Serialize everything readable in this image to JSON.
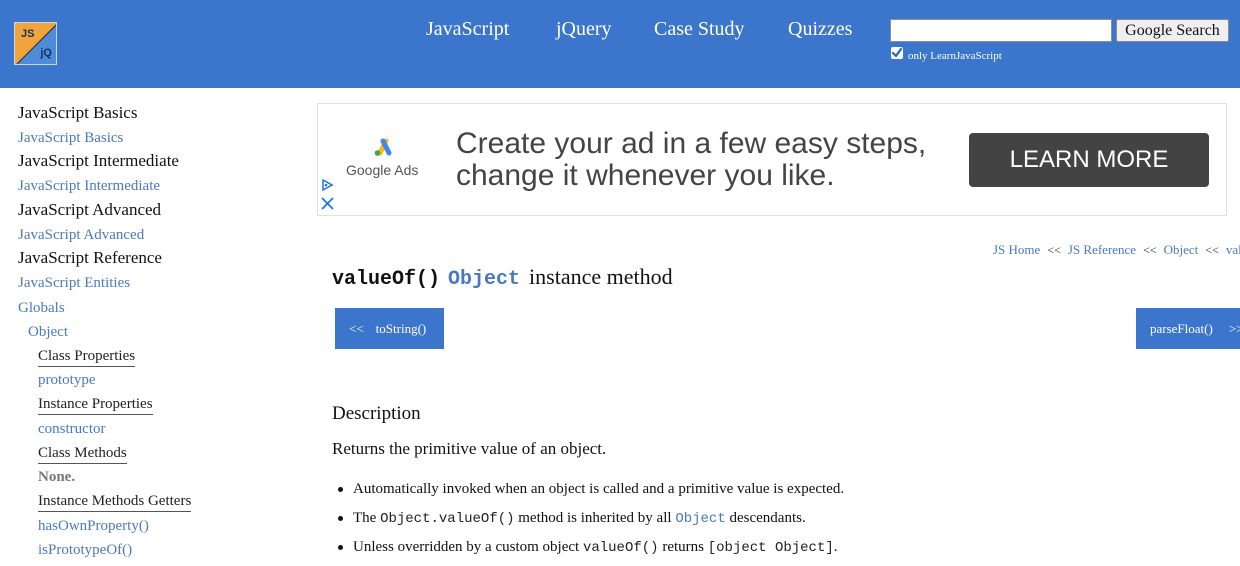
{
  "header": {
    "logo_top": "JS",
    "logo_bottom": "jQ",
    "nav": [
      "JavaScript",
      "jQuery",
      "Case Study",
      "Quizzes"
    ],
    "search_value": "",
    "search_button": "Google Search",
    "only_label": "only LearnJavaScript",
    "only_checked": true,
    "colors": {
      "bar": "#3b76cc",
      "logo_orange": "#f0a53c",
      "logo_blue": "#4e8bd8"
    }
  },
  "sidebar": [
    {
      "label": "JavaScript Basics",
      "style": "head"
    },
    {
      "label": "JavaScript Basics",
      "style": "link"
    },
    {
      "label": "JavaScript Intermediate",
      "style": "head"
    },
    {
      "label": "JavaScript Intermediate",
      "style": "link"
    },
    {
      "label": "JavaScript Advanced",
      "style": "head"
    },
    {
      "label": "JavaScript Advanced",
      "style": "link"
    },
    {
      "label": "JavaScript Reference",
      "style": "head"
    },
    {
      "label": "JavaScript Entities",
      "style": "link"
    },
    {
      "label": "Globals",
      "style": "link"
    },
    {
      "label": "Object",
      "style": "link"
    },
    {
      "label": "Class Properties",
      "style": "underlined"
    },
    {
      "label": "prototype",
      "style": "link"
    },
    {
      "label": "Instance Properties",
      "style": "underlined"
    },
    {
      "label": "constructor",
      "style": "link"
    },
    {
      "label": "Class Methods",
      "style": "underlined"
    },
    {
      "label": "None.",
      "style": "bold-muted"
    },
    {
      "label": "Instance Methods Getters",
      "style": "underlined"
    },
    {
      "label": "hasOwnProperty()",
      "style": "link"
    },
    {
      "label": "isPrototypeOf()",
      "style": "link"
    }
  ],
  "ad": {
    "brand": "Google Ads",
    "headline_line1": "Create your ad in a few easy steps,",
    "headline_line2": "change it whenever you like.",
    "cta": "LEARN MORE",
    "choices_icon": "ad-choices-icon",
    "close_icon": "close-icon"
  },
  "breadcrumb": [
    "JS Home",
    "JS Reference",
    "Object",
    "valueOf()"
  ],
  "breadcrumb_separator": "<<",
  "title": {
    "method": "valueOf()",
    "object": "Object",
    "suffix": "instance method"
  },
  "pager": {
    "prev_arrow": "<<",
    "prev_label": "toString()",
    "next_label": "parseFloat()",
    "next_arrow": ">>"
  },
  "description": {
    "heading": "Description",
    "text": "Returns the primitive value of an object.",
    "bullet1": "Automatically invoked when an object is called and a primitive value is expected.",
    "bullet2_a": "The",
    "bullet2_code": "Object.valueOf()",
    "bullet2_b": "method is inherited by all",
    "bullet2_link": "Object",
    "bullet2_c": "descendants.",
    "bullet3_a": "Unless overridden by a custom object",
    "bullet3_code1": "valueOf()",
    "bullet3_b": "returns",
    "bullet3_code2": "[object Object]",
    "bullet3_c": "."
  }
}
